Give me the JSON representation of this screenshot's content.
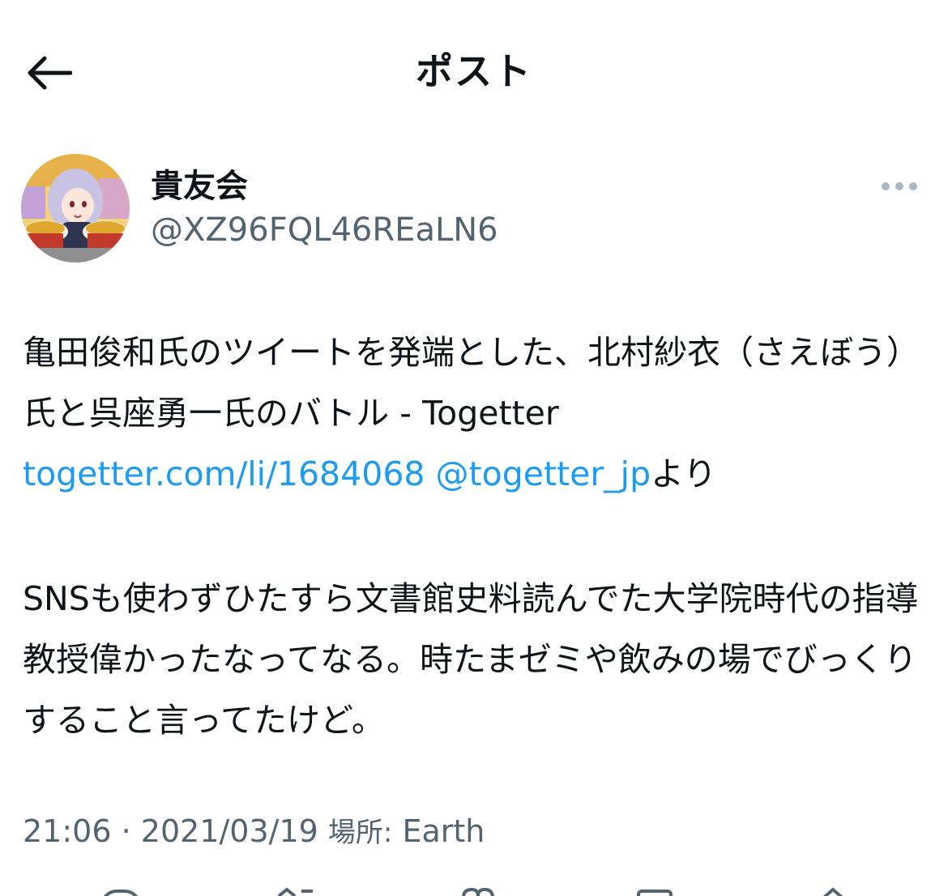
{
  "header": {
    "title": "ポスト",
    "back_icon": "back-arrow-icon"
  },
  "author": {
    "display_name": "貴友会",
    "handle": "@XZ96FQL46REaLN6",
    "avatar_icon": "avatar-anime-girl",
    "more_icon": "more-horizontal-icon"
  },
  "tweet": {
    "text_part1": "亀田俊和氏のツイートを発端とした、北村紗衣（さえぼう）氏と呉座勇一氏のバトル - Togetter",
    "link_url": "togetter.com/li/1684068",
    "link_mention": "@togetter_jp",
    "text_after_link": "より",
    "text_part2": "SNSも使わずひたすら文書館史料読んでた大学院時代の指導教授偉かったなってなる。時たまゼミや飲みの場でびっくりすること言ってたけど。"
  },
  "meta": {
    "time": "21:06",
    "separator": "·",
    "date": "2021/03/19",
    "location_label": "場所:",
    "location": "Earth"
  },
  "actions": [
    {
      "name": "reply",
      "icon": "reply-icon"
    },
    {
      "name": "retweet",
      "icon": "retweet-icon"
    },
    {
      "name": "like",
      "icon": "heart-icon"
    },
    {
      "name": "bookmark",
      "icon": "bookmark-icon"
    },
    {
      "name": "share",
      "icon": "share-icon"
    }
  ],
  "colors": {
    "link": "#1d9bf0",
    "secondary_text": "#536471",
    "primary_text": "#0f1419"
  }
}
